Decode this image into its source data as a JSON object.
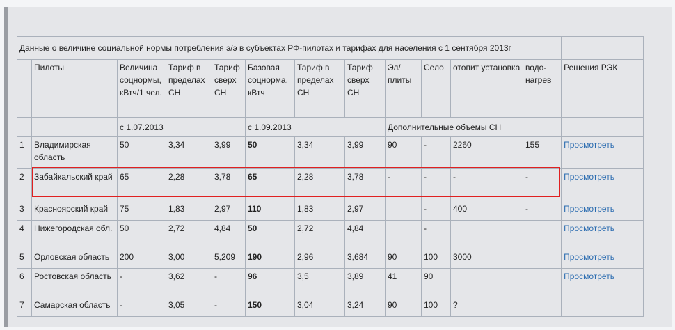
{
  "table": {
    "title": "Данные о величине социальной нормы потребления э/э в  субъектах РФ-пилотах и тарифах для населения  с 1 сентября 2013г",
    "headers": [
      "",
      "Пилоты",
      "Величина соцнормы, кВтч/1 чел.",
      "Тариф в пределах СН",
      "Тариф сверх СН",
      "Базовая соцнорма, кВтч",
      "Тариф в пределах СН",
      "Тариф сверх СН",
      "Эл/ плиты",
      "Село",
      "отопит установка",
      "водо-нагрев",
      "Решения РЭК"
    ],
    "subheaders": {
      "from_1_07": "с 1.07.2013",
      "from_1_09": "с 1.09.2013",
      "additional": "Дополнительные объемы СН"
    },
    "rows": [
      {
        "n": "1",
        "region": "Владимирская область",
        "norm": "50",
        "t_in": "3,34",
        "t_over": "3,99",
        "base": "50",
        "t2_in": "3,34",
        "t2_over": "3,99",
        "plates": "90",
        "village": "-",
        "heating": "2260",
        "water": "155",
        "action": "Просмотреть"
      },
      {
        "n": "2",
        "region": "Забайкальский край",
        "norm": "65",
        "t_in": "2,28",
        "t_over": "3,78",
        "base": "65",
        "t2_in": "2,28",
        "t2_over": "3,78",
        "plates": "-",
        "village": "-",
        "heating": "-",
        "water": "-",
        "action": "Просмотреть"
      },
      {
        "n": "3",
        "region": "Красноярский край",
        "norm": "75",
        "t_in": "1,83",
        "t_over": "2,97",
        "base": "110",
        "t2_in": "1,83",
        "t2_over": "2,97",
        "plates": "",
        "village": "-",
        "heating": "400",
        "water": "-",
        "action": "Просмотреть"
      },
      {
        "n": "4",
        "region": "Нижегородская обл.",
        "norm": "50",
        "t_in": "2,72",
        "t_over": "4,84",
        "base": "50",
        "t2_in": "2,72",
        "t2_over": "4,84",
        "plates": "",
        "village": "-",
        "heating": "",
        "water": "",
        "action": "Просмотреть"
      },
      {
        "n": "5",
        "region": "Орловская область",
        "norm": "200",
        "t_in": "3,00",
        "t_over": "5,209",
        "base": "190",
        "t2_in": "2,96",
        "t2_over": "3,684",
        "plates": "90",
        "village": "100",
        "heating": "3000",
        "water": "",
        "action": "Просмотреть"
      },
      {
        "n": "6",
        "region": "Ростовская область",
        "norm": "-",
        "t_in": "3,62",
        "t_over": "-",
        "base": "96",
        "t2_in": "3,5",
        "t2_over": "3,89",
        "plates": "41",
        "village": "90",
        "heating": "",
        "water": "",
        "action": "Просмотреть"
      },
      {
        "n": "7",
        "region": "Самарская область",
        "norm": "-",
        "t_in": "3,05",
        "t_over": "-",
        "base": "150",
        "t2_in": "3,04",
        "t2_over": "3,24",
        "plates": "90",
        "village": "100",
        "heating": "?",
        "water": "",
        "action": ""
      }
    ]
  }
}
